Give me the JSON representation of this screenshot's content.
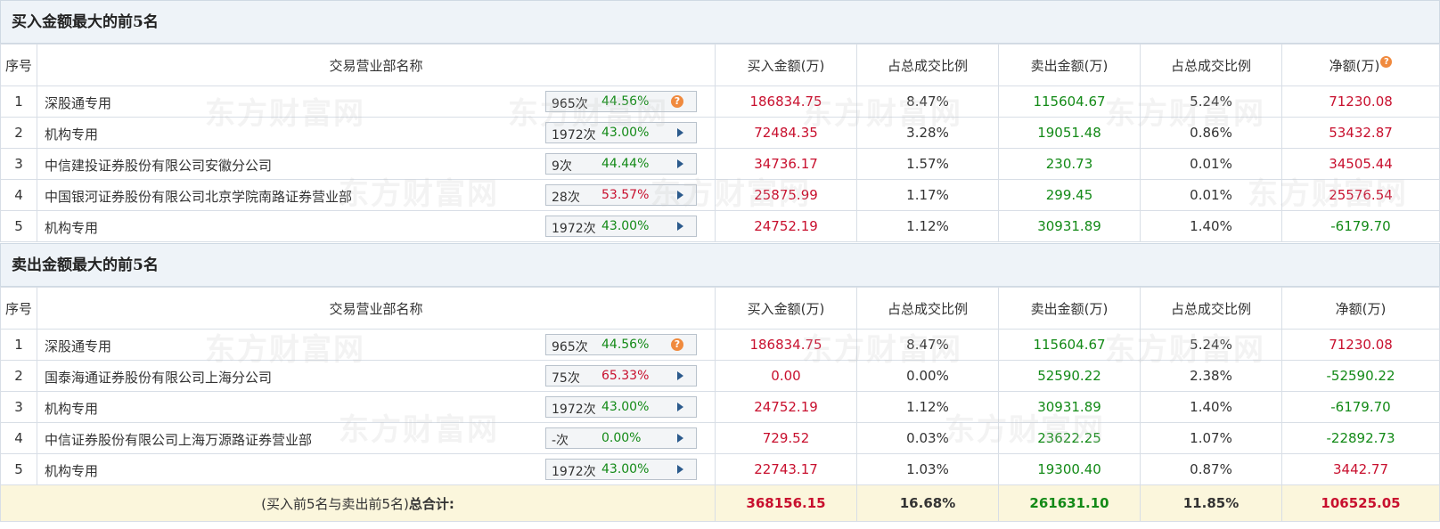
{
  "colors": {
    "up": "#c8102e",
    "down": "#138a17",
    "header_bg": "#eef3f8",
    "total_bg": "#fbf6dc",
    "help_icon": "#f08a3e",
    "arrow": "#2b5a8c"
  },
  "watermark_text": "东方财富网",
  "columns": [
    "序号",
    "交易营业部名称",
    "买入金额(万)",
    "占总成交比例",
    "卖出金额(万)",
    "占总成交比例",
    "净额(万)"
  ],
  "buy_section": {
    "title": "买入金额最大的前5名",
    "rows": [
      {
        "idx": "1",
        "name": "深股通专用",
        "count": "965次",
        "rate": "44.56%",
        "rate_color": "green",
        "icon": "help-icon",
        "buy": "186834.75",
        "buy_pct": "8.47%",
        "sell": "115604.67",
        "sell_pct": "5.24%",
        "net": "71230.08",
        "net_color": "red"
      },
      {
        "idx": "2",
        "name": "机构专用",
        "count": "1972次",
        "rate": "43.00%",
        "rate_color": "green",
        "icon": "arrow-right-icon",
        "buy": "72484.35",
        "buy_pct": "3.28%",
        "sell": "19051.48",
        "sell_pct": "0.86%",
        "net": "53432.87",
        "net_color": "red"
      },
      {
        "idx": "3",
        "name": "中信建投证券股份有限公司安徽分公司",
        "count": "9次",
        "rate": "44.44%",
        "rate_color": "green",
        "icon": "arrow-right-icon",
        "buy": "34736.17",
        "buy_pct": "1.57%",
        "sell": "230.73",
        "sell_pct": "0.01%",
        "net": "34505.44",
        "net_color": "red"
      },
      {
        "idx": "4",
        "name": "中国银河证券股份有限公司北京学院南路证券营业部",
        "count": "28次",
        "rate": "53.57%",
        "rate_color": "red",
        "icon": "arrow-right-icon",
        "buy": "25875.99",
        "buy_pct": "1.17%",
        "sell": "299.45",
        "sell_pct": "0.01%",
        "net": "25576.54",
        "net_color": "red"
      },
      {
        "idx": "5",
        "name": "机构专用",
        "count": "1972次",
        "rate": "43.00%",
        "rate_color": "green",
        "icon": "arrow-right-icon",
        "buy": "24752.19",
        "buy_pct": "1.12%",
        "sell": "30931.89",
        "sell_pct": "1.40%",
        "net": "-6179.70",
        "net_color": "green"
      }
    ]
  },
  "sell_section": {
    "title": "卖出金额最大的前5名",
    "rows": [
      {
        "idx": "1",
        "name": "深股通专用",
        "count": "965次",
        "rate": "44.56%",
        "rate_color": "green",
        "icon": "help-icon",
        "buy": "186834.75",
        "buy_pct": "8.47%",
        "sell": "115604.67",
        "sell_pct": "5.24%",
        "net": "71230.08",
        "net_color": "red"
      },
      {
        "idx": "2",
        "name": "国泰海通证券股份有限公司上海分公司",
        "count": "75次",
        "rate": "65.33%",
        "rate_color": "red",
        "icon": "arrow-right-icon",
        "buy": "0.00",
        "buy_pct": "0.00%",
        "sell": "52590.22",
        "sell_pct": "2.38%",
        "net": "-52590.22",
        "net_color": "green"
      },
      {
        "idx": "3",
        "name": "机构专用",
        "count": "1972次",
        "rate": "43.00%",
        "rate_color": "green",
        "icon": "arrow-right-icon",
        "buy": "24752.19",
        "buy_pct": "1.12%",
        "sell": "30931.89",
        "sell_pct": "1.40%",
        "net": "-6179.70",
        "net_color": "green"
      },
      {
        "idx": "4",
        "name": "中信证券股份有限公司上海万源路证券营业部",
        "count": "-次",
        "rate": "0.00%",
        "rate_color": "green",
        "icon": "arrow-right-icon",
        "buy": "729.52",
        "buy_pct": "0.03%",
        "sell": "23622.25",
        "sell_pct": "1.07%",
        "net": "-22892.73",
        "net_color": "green"
      },
      {
        "idx": "5",
        "name": "机构专用",
        "count": "1972次",
        "rate": "43.00%",
        "rate_color": "green",
        "icon": "arrow-right-icon",
        "buy": "22743.17",
        "buy_pct": "1.03%",
        "sell": "19300.40",
        "sell_pct": "0.87%",
        "net": "3442.77",
        "net_color": "red"
      }
    ]
  },
  "total": {
    "label_prefix": "(买入前5名与卖出前5名)",
    "label_suffix": "总合计:",
    "buy": "368156.15",
    "buy_pct": "16.68%",
    "sell": "261631.10",
    "sell_pct": "11.85%",
    "net": "106525.05"
  }
}
